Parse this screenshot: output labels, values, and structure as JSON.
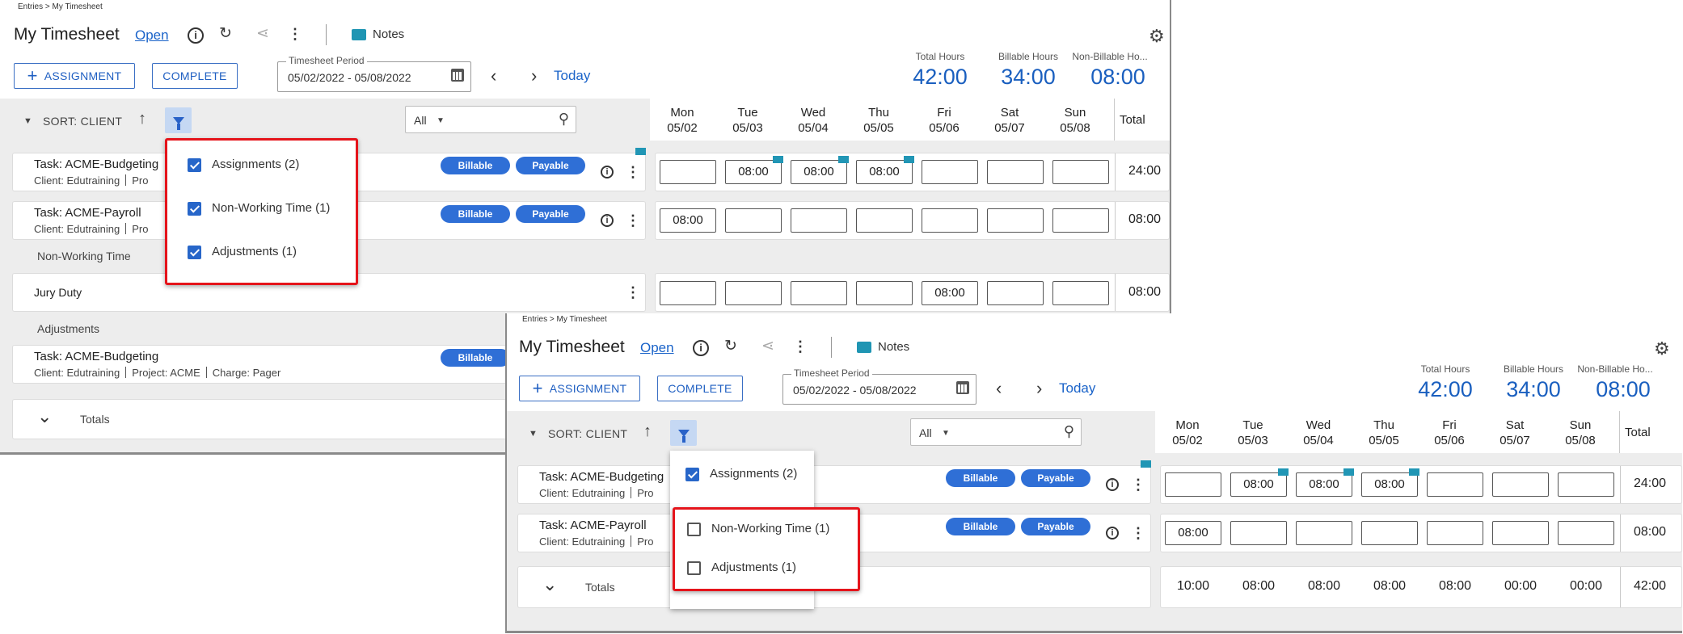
{
  "breadcrumb": "Entries > My Timesheet",
  "title": "My Timesheet",
  "status_link": "Open",
  "notes_label": "Notes",
  "buttons": {
    "assignment": "ASSIGNMENT",
    "complete": "COMPLETE"
  },
  "period": {
    "label": "Timesheet Period",
    "value": "05/02/2022 - 05/08/2022"
  },
  "today_label": "Today",
  "summary": [
    {
      "label": "Total Hours",
      "value": "42:00"
    },
    {
      "label": "Billable Hours",
      "value": "34:00"
    },
    {
      "label": "Non-Billable Ho...",
      "value": "08:00"
    }
  ],
  "sort_label": "SORT: CLIENT",
  "filter_select_value": "All",
  "days": [
    {
      "name": "Mon",
      "date": "05/02"
    },
    {
      "name": "Tue",
      "date": "05/03"
    },
    {
      "name": "Wed",
      "date": "05/04"
    },
    {
      "name": "Thu",
      "date": "05/05"
    },
    {
      "name": "Fri",
      "date": "05/06"
    },
    {
      "name": "Sat",
      "date": "05/07"
    },
    {
      "name": "Sun",
      "date": "05/08"
    }
  ],
  "total_header": "Total",
  "rows": {
    "budgeting": {
      "task": "Task: ACME-Budgeting",
      "client": "Client: Edutraining",
      "project_trunc": "Pro",
      "tags": [
        "Billable",
        "Payable"
      ],
      "cells": [
        "",
        "08:00",
        "08:00",
        "08:00",
        "",
        "",
        ""
      ],
      "total": "24:00"
    },
    "payroll": {
      "task": "Task: ACME-Payroll",
      "client": "Client: Edutraining",
      "project_trunc": "Pro",
      "tags": [
        "Billable",
        "Payable"
      ],
      "cells": [
        "08:00",
        "",
        "",
        "",
        "",
        "",
        ""
      ],
      "total": "08:00"
    },
    "nonworking_group": "Non-Working Time",
    "jury": {
      "task": "Jury Duty",
      "cells": [
        "",
        "",
        "",
        "",
        "08:00",
        "",
        ""
      ],
      "total": "08:00"
    },
    "adjustments_group": "Adjustments",
    "adjustment": {
      "task": "Task: ACME-Budgeting",
      "client": "Client: Edutraining",
      "project": "Project: ACME",
      "charge": "Charge: Pager",
      "tag": "Billable"
    }
  },
  "totals_label": "Totals",
  "totals_values": [
    "10:00",
    "08:00",
    "08:00",
    "08:00",
    "08:00",
    "00:00",
    "00:00",
    "42:00"
  ],
  "filter_options_before": [
    {
      "label": "Assignments (2)",
      "checked": true
    },
    {
      "label": "Non-Working Time (1)",
      "checked": true
    },
    {
      "label": "Adjustments (1)",
      "checked": true
    }
  ],
  "filter_options_after": [
    {
      "label": "Assignments (2)",
      "checked": true
    },
    {
      "label": "Non-Working Time (1)",
      "checked": false
    },
    {
      "label": "Adjustments (1)",
      "checked": false
    }
  ],
  "colors": {
    "accent": "#1a5fbf",
    "highlight": "#e5141b",
    "flag": "#2196b5"
  }
}
